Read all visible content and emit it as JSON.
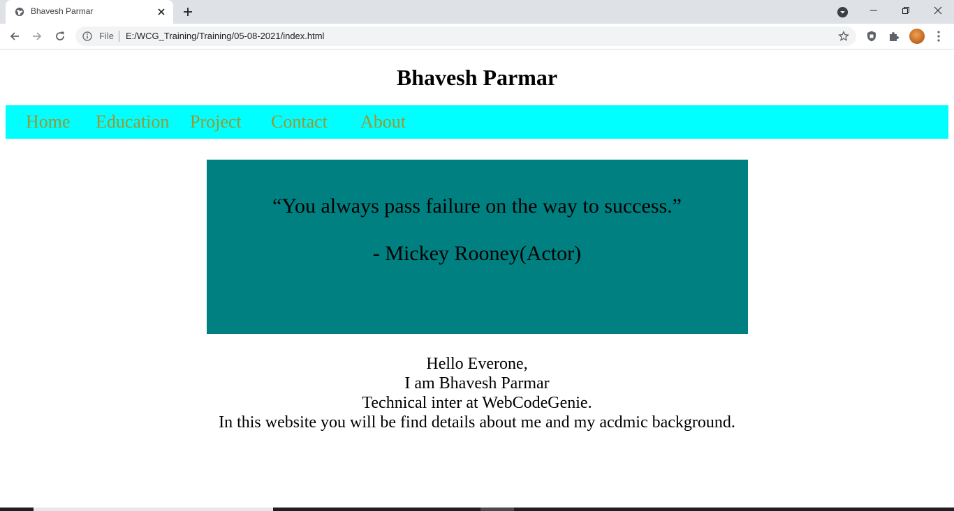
{
  "browser": {
    "tab_title": "Bhavesh Parmar",
    "omnibox": {
      "scheme_label": "File",
      "url": "E:/WCG_Training/Training/05-08-2021/index.html"
    }
  },
  "page": {
    "title": "Bhavesh Parmar",
    "nav": {
      "items": [
        {
          "label": "Home"
        },
        {
          "label": "Education"
        },
        {
          "label": "Project"
        },
        {
          "label": "Contact"
        },
        {
          "label": "About"
        }
      ]
    },
    "quote": {
      "text": "“You always pass failure on the way to success.”",
      "author": "- Mickey Rooney(Actor)"
    },
    "intro": {
      "lines": [
        "Hello Everone,",
        "I am Bhavesh Parmar",
        "Technical inter at WebCodeGenie.",
        "In this website you will be find details about me and my acdmic background."
      ]
    }
  },
  "colors": {
    "navbar_bg": "#00ffff",
    "nav_link": "#b8860b",
    "quote_bg": "#008080",
    "tabstrip_bg": "#dee1e6"
  },
  "icons": {
    "tab_favicon": "globe-icon",
    "tab_close": "close-icon",
    "new_tab": "plus-icon",
    "tab_search": "tab-search-icon",
    "back": "arrow-left-icon",
    "forward": "arrow-right-icon",
    "reload": "reload-icon",
    "site_info": "info-icon",
    "bookmark": "star-icon",
    "extension_shield": "shield-icon",
    "extensions": "puzzle-icon",
    "menu": "three-dots-icon"
  }
}
